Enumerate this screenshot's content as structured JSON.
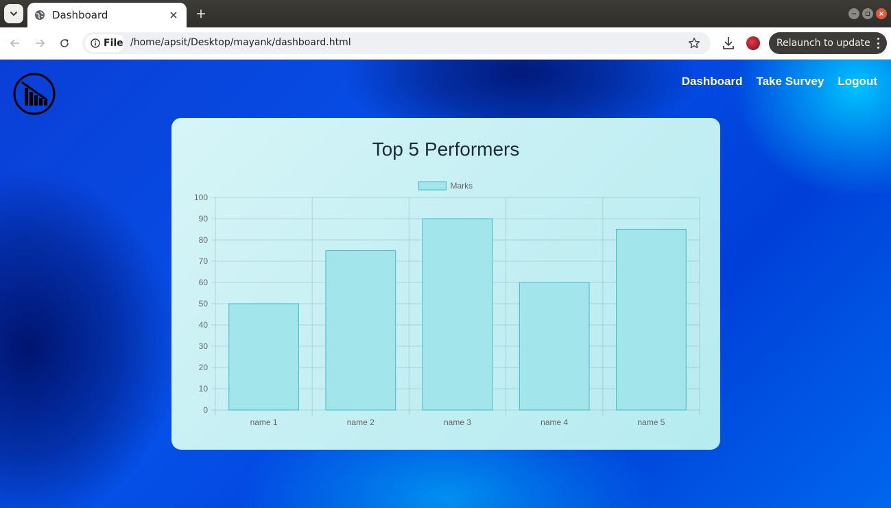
{
  "browser": {
    "tab_title": "Dashboard",
    "url_chip_label": "File",
    "url": "/home/apsit/Desktop/mayank/dashboard.html",
    "relaunch_label": "Relaunch to update"
  },
  "nav": {
    "items": [
      {
        "label": "Dashboard"
      },
      {
        "label": "Take Survey"
      },
      {
        "label": "Logout"
      }
    ]
  },
  "card": {
    "title": "Top 5 Performers"
  },
  "chart_data": {
    "type": "bar",
    "categories": [
      "name 1",
      "name 2",
      "name 3",
      "name 4",
      "name 5"
    ],
    "series": [
      {
        "name": "Marks",
        "values": [
          50,
          75,
          90,
          60,
          85
        ]
      }
    ],
    "ylim": [
      0,
      100
    ],
    "yticks": [
      0,
      10,
      20,
      30,
      40,
      50,
      60,
      70,
      80,
      90,
      100
    ],
    "grid": true,
    "legend": "top-center",
    "bar_fill": "#a2e5ea",
    "bar_stroke": "#4fc4cc"
  }
}
